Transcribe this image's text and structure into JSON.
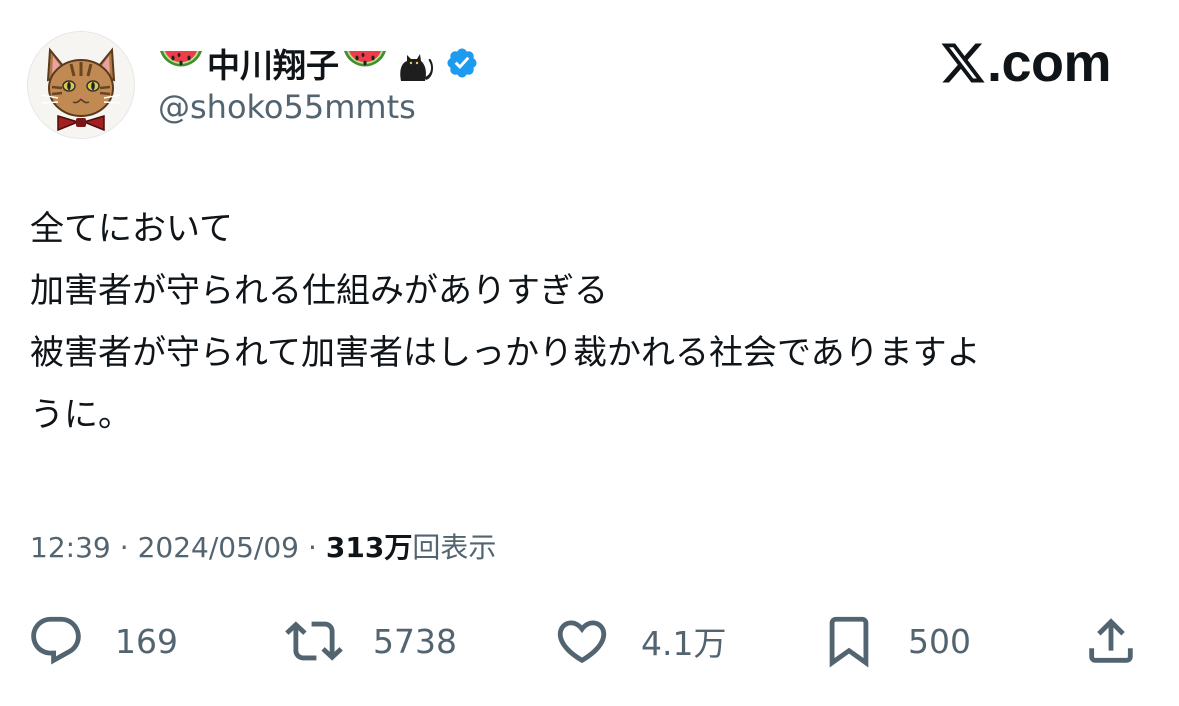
{
  "author": {
    "display_name": "中川翔子",
    "handle": "@shoko55mmts",
    "name_icons": [
      "watermelon-icon",
      "watermelon-icon",
      "black-cat-icon"
    ],
    "verified": true,
    "verified_color": "#1d9bf0"
  },
  "site": {
    "logo_icon": "x-logo-icon",
    "domain": ".com"
  },
  "tweet": {
    "lines": [
      "全てにおいて",
      "加害者が守られる仕組みがありすぎる",
      "被害者が守られて加害者はしっかり裁かれる社会でありますよ",
      "うに。"
    ]
  },
  "meta": {
    "time": "12:39",
    "separator": "·",
    "date": "2024/05/09",
    "views_count": "313万",
    "views_label": "回表示"
  },
  "actions": {
    "reply_count": "169",
    "retweet_count": "5738",
    "like_count": "4.1万",
    "bookmark_count": "500"
  },
  "colors": {
    "text_primary": "#0f1419",
    "text_secondary": "#536471",
    "background": "#ffffff"
  }
}
